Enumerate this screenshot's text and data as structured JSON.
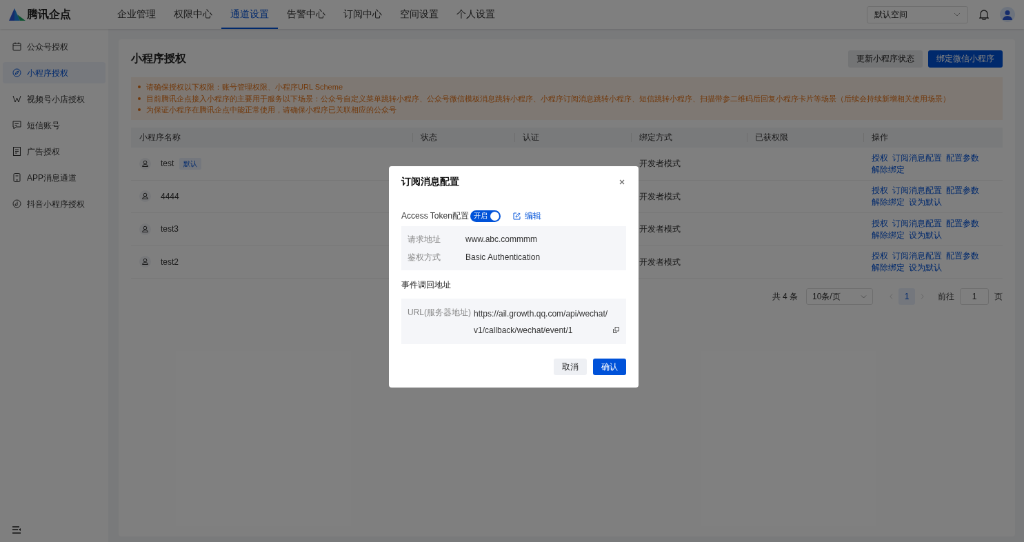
{
  "logo": {
    "text": "腾讯企点"
  },
  "nav": [
    {
      "label": "企业管理",
      "selected": false
    },
    {
      "label": "权限中心",
      "selected": false
    },
    {
      "label": "通道设置",
      "selected": true
    },
    {
      "label": "告警中心",
      "selected": false
    },
    {
      "label": "订阅中心",
      "selected": false
    },
    {
      "label": "空间设置",
      "selected": false
    },
    {
      "label": "个人设置",
      "selected": false
    }
  ],
  "space_select": {
    "value": "默认空间"
  },
  "sidebar": {
    "items": [
      {
        "label": "公众号授权",
        "selected": false
      },
      {
        "label": "小程序授权",
        "selected": true
      },
      {
        "label": "视频号小店授权",
        "selected": false
      },
      {
        "label": "短信账号",
        "selected": false
      },
      {
        "label": "广告授权",
        "selected": false
      },
      {
        "label": "APP消息通道",
        "selected": false
      },
      {
        "label": "抖音小程序授权",
        "selected": false
      }
    ]
  },
  "page": {
    "title": "小程序授权",
    "buttons": [
      {
        "label": "更新小程序状态",
        "kind": "secondary"
      },
      {
        "label": "绑定微信小程序",
        "kind": "primary"
      }
    ],
    "notices": [
      "请确保授权以下权限：账号管理权限、小程序URL Scheme",
      "目前腾讯企点接入小程序的主要用于服务以下场景：公众号自定义菜单跳转小程序、公众号微信模板消息跳转小程序、小程序订阅消息跳转小程序、短信跳转小程序、扫描带参二维码后回复小程序卡片等场景（后续会持续新增相关使用场景）",
      "为保证小程序在腾讯企点中能正常使用，请确保小程序已关联相应的公众号"
    ],
    "table": {
      "columns": [
        "小程序名称",
        "状态",
        "认证",
        "绑定方式",
        "已获权限",
        "操作"
      ],
      "rows": [
        {
          "name": "test",
          "tag": "默认",
          "binding": "开发者模式",
          "actions": [
            "授权",
            "订阅消息配置",
            "配置参数",
            "解除绑定"
          ]
        },
        {
          "name": "4444",
          "binding": "开发者模式",
          "actions": [
            "授权",
            "订阅消息配置",
            "配置参数",
            "解除绑定",
            "设为默认"
          ]
        },
        {
          "name": "test3",
          "binding": "开发者模式",
          "actions": [
            "授权",
            "订阅消息配置",
            "配置参数",
            "解除绑定",
            "设为默认"
          ]
        },
        {
          "name": "test2",
          "binding": "开发者模式",
          "actions": [
            "授权",
            "订阅消息配置",
            "配置参数",
            "解除绑定",
            "设为默认"
          ]
        }
      ]
    },
    "pagination": {
      "total": "共 4 条",
      "page_size": "10条/页",
      "pages": [
        {
          "label": "1",
          "selected": true
        }
      ],
      "goto_label": "前往",
      "goto_value": "1",
      "page_unit": "页"
    }
  },
  "dialog": {
    "title": "订阅消息配置",
    "token_label": "Access Token配置",
    "toggle": {
      "on": true,
      "label": "开启"
    },
    "edit_link": "编辑",
    "info": [
      {
        "label": "请求地址",
        "value": "www.abc.commmm"
      },
      {
        "label": "鉴权方式",
        "value": "Basic Authentication"
      }
    ],
    "callback_title": "事件调回地址",
    "callback": {
      "label": "URL(服务器地址)",
      "value": "https://ail.growth.qq.com/api/wechat/v1/callback/wechat/event/1"
    },
    "buttons": [
      {
        "label": "取消",
        "kind": "secondary"
      },
      {
        "label": "确认",
        "kind": "primary"
      }
    ]
  }
}
